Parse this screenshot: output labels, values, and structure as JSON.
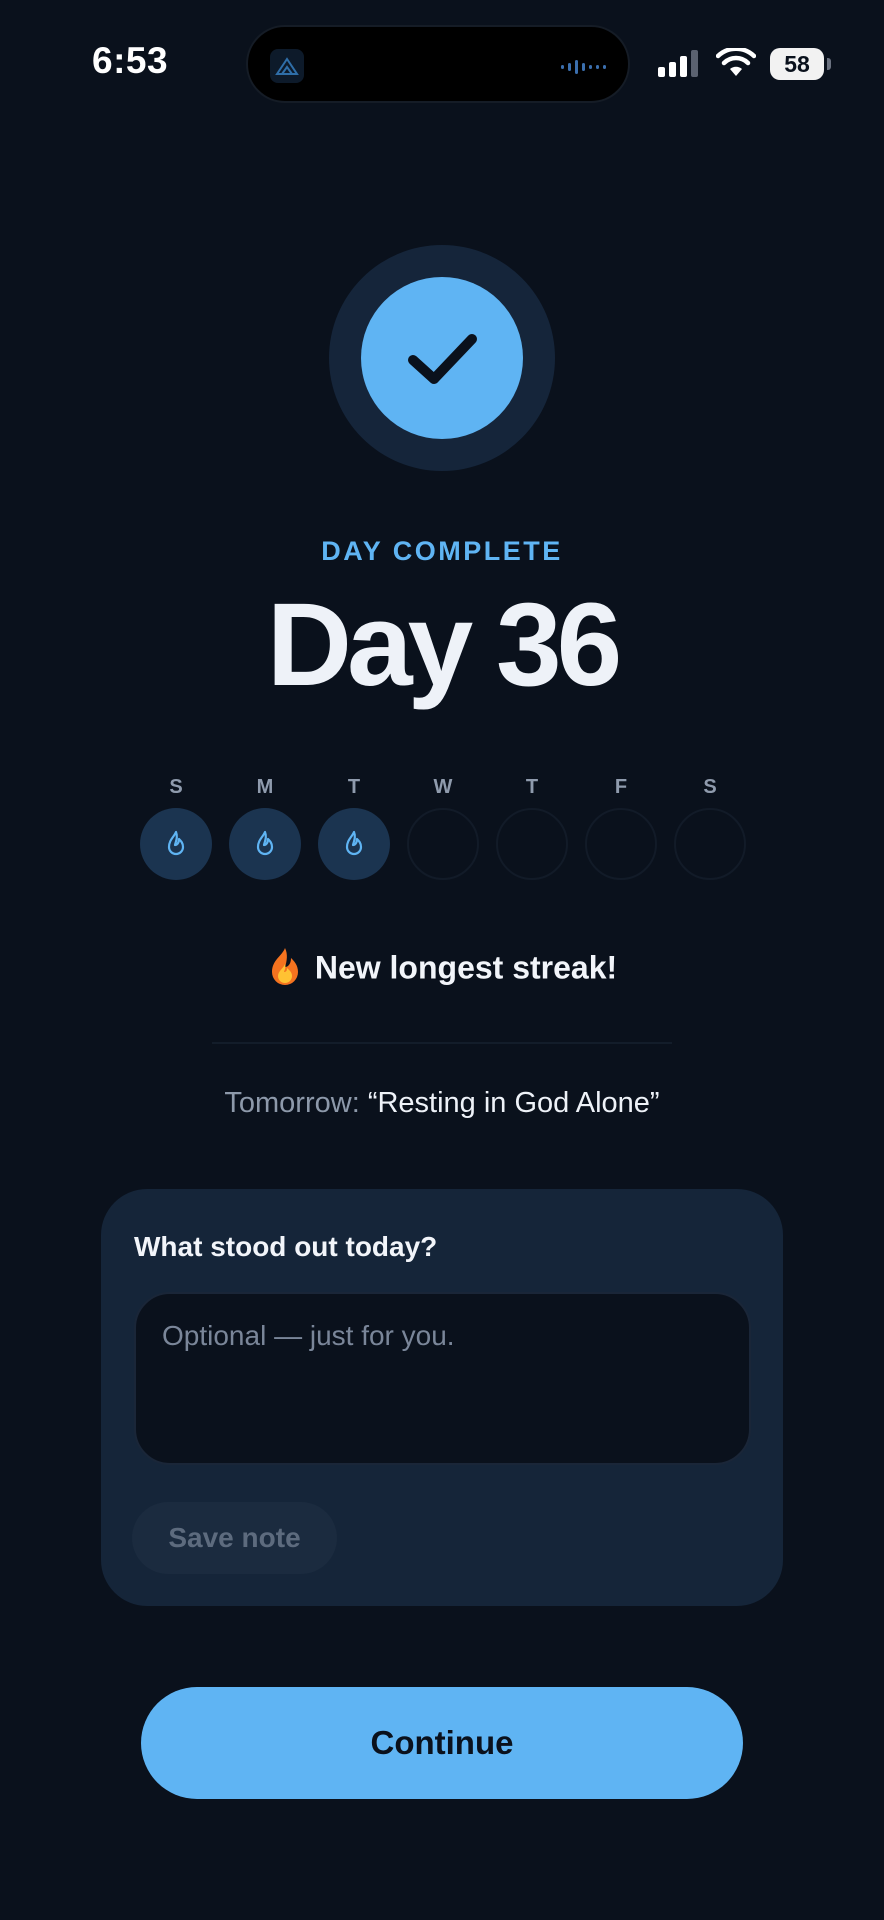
{
  "status_bar": {
    "time": "6:53",
    "battery": "58"
  },
  "completion": {
    "label": "DAY COMPLETE",
    "title": "Day 36"
  },
  "week": {
    "days": [
      {
        "letter": "S",
        "done": true
      },
      {
        "letter": "M",
        "done": true
      },
      {
        "letter": "T",
        "done": true
      },
      {
        "letter": "W",
        "done": false
      },
      {
        "letter": "T",
        "done": false
      },
      {
        "letter": "F",
        "done": false
      },
      {
        "letter": "S",
        "done": false
      }
    ]
  },
  "streak": {
    "emoji": "🔥",
    "text": "New longest streak!"
  },
  "tomorrow": {
    "prefix": "Tomorrow:",
    "title": "“Resting in God Alone”"
  },
  "note_card": {
    "title": "What stood out today?",
    "placeholder": "Optional — just for you.",
    "value": "",
    "save_label": "Save note"
  },
  "continue_label": "Continue",
  "colors": {
    "background": "#0a111c",
    "accent": "#5fb4f3",
    "card": "#152539"
  },
  "icons": {
    "badge": "checkmark-icon",
    "day_done": "flame-icon"
  }
}
